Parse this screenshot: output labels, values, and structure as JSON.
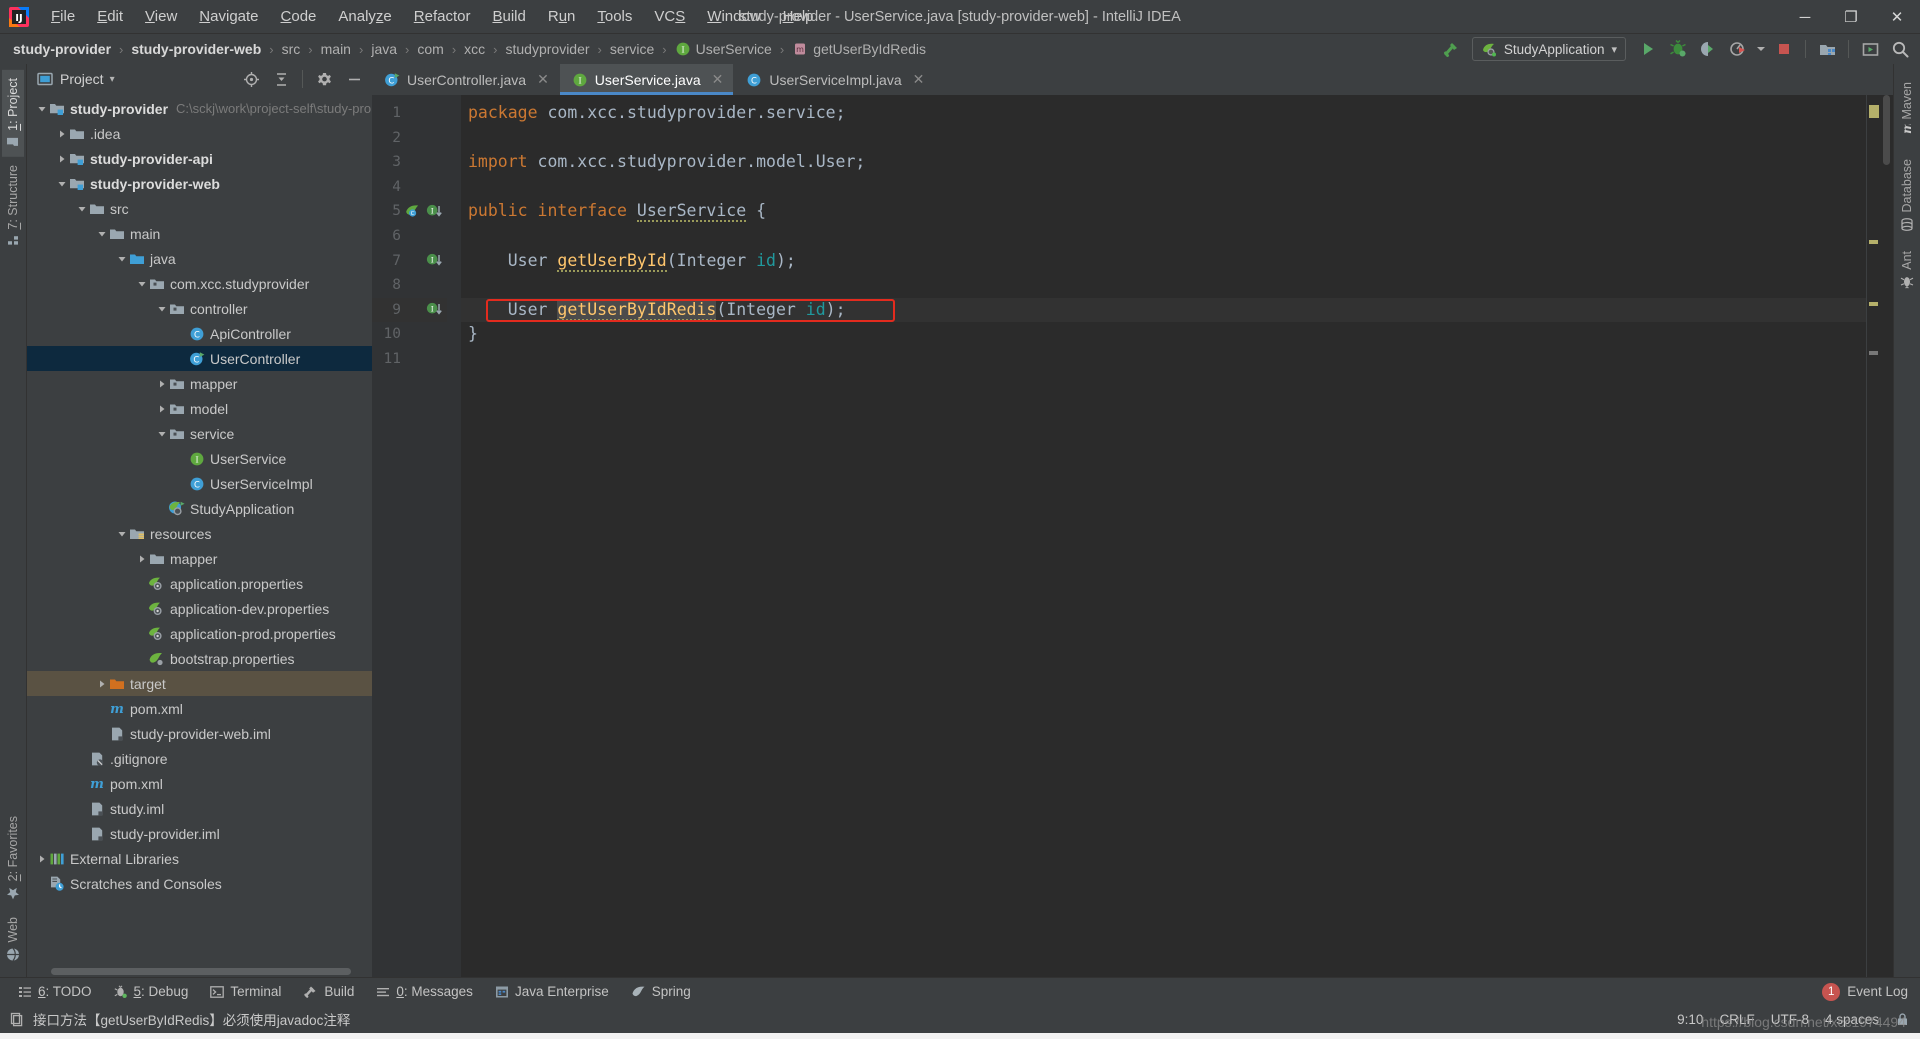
{
  "window": {
    "title": "study-provider - UserService.java [study-provider-web] - IntelliJ IDEA",
    "minimize": "─",
    "maximize": "❐",
    "close": "✕"
  },
  "menu": {
    "items": [
      {
        "label": "File",
        "mnemonic": "F"
      },
      {
        "label": "Edit",
        "mnemonic": "E"
      },
      {
        "label": "View",
        "mnemonic": "V"
      },
      {
        "label": "Navigate",
        "mnemonic": "N"
      },
      {
        "label": "Code",
        "mnemonic": "C"
      },
      {
        "label": "Analyze",
        "mnemonic": "z"
      },
      {
        "label": "Refactor",
        "mnemonic": "R"
      },
      {
        "label": "Build",
        "mnemonic": "B"
      },
      {
        "label": "Run",
        "mnemonic": "u"
      },
      {
        "label": "Tools",
        "mnemonic": "T"
      },
      {
        "label": "VCS",
        "mnemonic": "S"
      },
      {
        "label": "Window",
        "mnemonic": "W"
      },
      {
        "label": "Help",
        "mnemonic": "H"
      }
    ]
  },
  "breadcrumb": {
    "items": [
      {
        "label": "study-provider",
        "bold": true,
        "icon": ""
      },
      {
        "label": "study-provider-web",
        "bold": true,
        "icon": ""
      },
      {
        "label": "src",
        "bold": false,
        "icon": ""
      },
      {
        "label": "main",
        "bold": false,
        "icon": ""
      },
      {
        "label": "java",
        "bold": false,
        "icon": ""
      },
      {
        "label": "com",
        "bold": false,
        "icon": ""
      },
      {
        "label": "xcc",
        "bold": false,
        "icon": ""
      },
      {
        "label": "studyprovider",
        "bold": false,
        "icon": ""
      },
      {
        "label": "service",
        "bold": false,
        "icon": ""
      },
      {
        "label": "UserService",
        "bold": false,
        "icon": "interface-icon"
      },
      {
        "label": "getUserByIdRedis",
        "bold": false,
        "icon": "method-icon"
      }
    ],
    "separator": "›"
  },
  "toolbar": {
    "run_config": "StudyApplication",
    "dropdown_caret": "▾",
    "buttons": [
      {
        "name": "build-hammer",
        "title": "Build Project"
      },
      {
        "name": "run-button",
        "title": "Run"
      },
      {
        "name": "debug-button",
        "title": "Debug"
      },
      {
        "name": "run-coverage-button",
        "title": "Run with Coverage"
      },
      {
        "name": "profiler-button",
        "title": "Profile"
      },
      {
        "name": "stop-button",
        "title": "Stop"
      },
      {
        "name": "project-structure-button",
        "title": "Project Structure"
      },
      {
        "name": "select-in-button",
        "title": "Select In"
      },
      {
        "name": "search-everywhere-button",
        "title": "Search Everywhere"
      }
    ]
  },
  "left_strip": {
    "top": [
      {
        "label": "1: Project",
        "mnemonic": "1",
        "active": true,
        "icon": "project-icon"
      },
      {
        "label": "7: Structure",
        "mnemonic": "7",
        "active": false,
        "icon": "structure-icon"
      }
    ],
    "bottom": [
      {
        "label": "2: Favorites",
        "mnemonic": "2",
        "active": false,
        "icon": "star-icon"
      },
      {
        "label": "Web",
        "mnemonic": "",
        "active": false,
        "icon": "web-icon"
      }
    ]
  },
  "right_strip": {
    "items": [
      {
        "label": "Maven",
        "icon": "maven-icon"
      },
      {
        "label": "Database",
        "icon": "database-icon"
      },
      {
        "label": "Ant",
        "icon": "ant-icon"
      }
    ]
  },
  "project_panel": {
    "title": "Project",
    "title_caret": "▾",
    "header_buttons": [
      {
        "name": "locate-icon",
        "title": "Select Opened File"
      },
      {
        "name": "collapse-all-icon",
        "title": "Collapse All"
      },
      {
        "name": "settings-gear-icon",
        "title": "Settings"
      },
      {
        "name": "hide-icon",
        "title": "Hide"
      }
    ],
    "tree": [
      {
        "label": "study-provider",
        "path": "C:\\sckj\\work\\project-self\\study-pro",
        "depth": 0,
        "arrow": "open",
        "icon": "module-folder-icon",
        "bold": true,
        "state": "none"
      },
      {
        "label": ".idea",
        "path": "",
        "depth": 1,
        "arrow": "closed",
        "icon": "folder-icon",
        "bold": false,
        "state": "none"
      },
      {
        "label": "study-provider-api",
        "path": "",
        "depth": 1,
        "arrow": "closed",
        "icon": "module-folder-icon",
        "bold": true,
        "state": "none"
      },
      {
        "label": "study-provider-web",
        "path": "",
        "depth": 1,
        "arrow": "open",
        "icon": "module-folder-icon",
        "bold": true,
        "state": "none"
      },
      {
        "label": "src",
        "path": "",
        "depth": 2,
        "arrow": "open",
        "icon": "folder-icon",
        "bold": false,
        "state": "none"
      },
      {
        "label": "main",
        "path": "",
        "depth": 3,
        "arrow": "open",
        "icon": "folder-icon",
        "bold": false,
        "state": "none"
      },
      {
        "label": "java",
        "path": "",
        "depth": 4,
        "arrow": "open",
        "icon": "source-folder-icon",
        "bold": false,
        "state": "none"
      },
      {
        "label": "com.xcc.studyprovider",
        "path": "",
        "depth": 5,
        "arrow": "open",
        "icon": "package-icon",
        "bold": false,
        "state": "none"
      },
      {
        "label": "controller",
        "path": "",
        "depth": 6,
        "arrow": "open",
        "icon": "package-icon",
        "bold": false,
        "state": "none"
      },
      {
        "label": "ApiController",
        "path": "",
        "depth": 7,
        "arrow": "none",
        "icon": "class-icon",
        "bold": false,
        "state": "none"
      },
      {
        "label": "UserController",
        "path": "",
        "depth": 7,
        "arrow": "none",
        "icon": "class-run-icon",
        "bold": false,
        "state": "selected"
      },
      {
        "label": "mapper",
        "path": "",
        "depth": 6,
        "arrow": "closed",
        "icon": "package-icon",
        "bold": false,
        "state": "none"
      },
      {
        "label": "model",
        "path": "",
        "depth": 6,
        "arrow": "closed",
        "icon": "package-icon",
        "bold": false,
        "state": "none"
      },
      {
        "label": "service",
        "path": "",
        "depth": 6,
        "arrow": "open",
        "icon": "package-icon",
        "bold": false,
        "state": "none"
      },
      {
        "label": "UserService",
        "path": "",
        "depth": 7,
        "arrow": "none",
        "icon": "interface-icon",
        "bold": false,
        "state": "none"
      },
      {
        "label": "UserServiceImpl",
        "path": "",
        "depth": 7,
        "arrow": "none",
        "icon": "class-icon",
        "bold": false,
        "state": "none"
      },
      {
        "label": "StudyApplication",
        "path": "",
        "depth": 6,
        "arrow": "none",
        "icon": "spring-class-icon",
        "bold": false,
        "state": "none"
      },
      {
        "label": "resources",
        "path": "",
        "depth": 4,
        "arrow": "open",
        "icon": "resources-folder-icon",
        "bold": false,
        "state": "none"
      },
      {
        "label": "mapper",
        "path": "",
        "depth": 5,
        "arrow": "closed",
        "icon": "folder-icon",
        "bold": false,
        "state": "none"
      },
      {
        "label": "application.properties",
        "path": "",
        "depth": 5,
        "arrow": "none",
        "icon": "spring-props-icon",
        "bold": false,
        "state": "none"
      },
      {
        "label": "application-dev.properties",
        "path": "",
        "depth": 5,
        "arrow": "none",
        "icon": "spring-props-icon",
        "bold": false,
        "state": "none"
      },
      {
        "label": "application-prod.properties",
        "path": "",
        "depth": 5,
        "arrow": "none",
        "icon": "spring-props-icon",
        "bold": false,
        "state": "none"
      },
      {
        "label": "bootstrap.properties",
        "path": "",
        "depth": 5,
        "arrow": "none",
        "icon": "spring-leaf-icon",
        "bold": false,
        "state": "none"
      },
      {
        "label": "target",
        "path": "",
        "depth": 3,
        "arrow": "closed",
        "icon": "excluded-folder-icon",
        "bold": false,
        "state": "highlighted"
      },
      {
        "label": "pom.xml",
        "path": "",
        "depth": 3,
        "arrow": "none",
        "icon": "maven-pom-icon",
        "bold": false,
        "state": "none"
      },
      {
        "label": "study-provider-web.iml",
        "path": "",
        "depth": 3,
        "arrow": "none",
        "icon": "iml-icon",
        "bold": false,
        "state": "none"
      },
      {
        "label": ".gitignore",
        "path": "",
        "depth": 2,
        "arrow": "none",
        "icon": "gitignore-icon",
        "bold": false,
        "state": "none"
      },
      {
        "label": "pom.xml",
        "path": "",
        "depth": 2,
        "arrow": "none",
        "icon": "maven-pom-icon",
        "bold": false,
        "state": "none"
      },
      {
        "label": "study.iml",
        "path": "",
        "depth": 2,
        "arrow": "none",
        "icon": "iml-icon",
        "bold": false,
        "state": "none"
      },
      {
        "label": "study-provider.iml",
        "path": "",
        "depth": 2,
        "arrow": "none",
        "icon": "iml-icon",
        "bold": false,
        "state": "none"
      },
      {
        "label": "External Libraries",
        "path": "",
        "depth": 0,
        "arrow": "closed",
        "icon": "libraries-icon",
        "bold": false,
        "state": "none"
      },
      {
        "label": "Scratches and Consoles",
        "path": "",
        "depth": 0,
        "arrow": "none",
        "icon": "scratches-icon",
        "bold": false,
        "state": "none"
      }
    ]
  },
  "editor": {
    "tabs": [
      {
        "label": "UserController.java",
        "icon": "class-run-icon",
        "active": false,
        "close": "✕"
      },
      {
        "label": "UserService.java",
        "icon": "interface-icon",
        "active": true,
        "close": "✕"
      },
      {
        "label": "UserServiceImpl.java",
        "icon": "class-icon",
        "active": false,
        "close": "✕"
      }
    ],
    "line_numbers": [
      "1",
      "2",
      "3",
      "4",
      "5",
      "6",
      "7",
      "8",
      "9",
      "10",
      "11"
    ],
    "current_line": 9,
    "code_lines": [
      {
        "n": 1,
        "tokens": [
          {
            "t": "package ",
            "c": "kw"
          },
          {
            "t": "com.xcc.studyprovider.service;",
            "c": "plain"
          }
        ]
      },
      {
        "n": 2,
        "tokens": []
      },
      {
        "n": 3,
        "tokens": [
          {
            "t": "import ",
            "c": "kw"
          },
          {
            "t": "com.xcc.studyprovider.model.User;",
            "c": "plain"
          }
        ]
      },
      {
        "n": 4,
        "tokens": []
      },
      {
        "n": 5,
        "tokens": [
          {
            "t": "public ",
            "c": "kw"
          },
          {
            "t": "interface ",
            "c": "kw"
          },
          {
            "t": "UserService",
            "c": "cls warnu"
          },
          {
            "t": " {",
            "c": "plain"
          }
        ]
      },
      {
        "n": 6,
        "tokens": []
      },
      {
        "n": 7,
        "tokens": [
          {
            "t": "    ",
            "c": "plain"
          },
          {
            "t": "User ",
            "c": "typ"
          },
          {
            "t": "getUserById",
            "c": "mth warnu"
          },
          {
            "t": "(",
            "c": "plain"
          },
          {
            "t": "Integer ",
            "c": "typ"
          },
          {
            "t": "id",
            "c": "param"
          },
          {
            "t": ");",
            "c": "plain"
          }
        ]
      },
      {
        "n": 8,
        "tokens": []
      },
      {
        "n": 9,
        "tokens": [
          {
            "t": "    ",
            "c": "plain"
          },
          {
            "t": "User ",
            "c": "typ"
          },
          {
            "t": "getUserByIdRedis",
            "c": "mth warnu ident-hl"
          },
          {
            "t": "(",
            "c": "plain"
          },
          {
            "t": "Integer ",
            "c": "typ"
          },
          {
            "t": "id",
            "c": "param"
          },
          {
            "t": ");",
            "c": "plain"
          }
        ]
      },
      {
        "n": 10,
        "tokens": [
          {
            "t": "}",
            "c": "plain"
          }
        ]
      },
      {
        "n": 11,
        "tokens": []
      }
    ],
    "gutter_marks": [
      {
        "line": 5,
        "icons": [
          "spring-bean-icon",
          "implemented-icon"
        ]
      },
      {
        "line": 7,
        "icons": [
          "implemented-icon"
        ]
      },
      {
        "line": 9,
        "icons": [
          "implemented-icon"
        ]
      }
    ],
    "intention_bulb": {
      "line": 9,
      "icon": "lightbulb-icon"
    },
    "annotation_box": {
      "line": 9,
      "color": "#e32b1e",
      "label": "red-highlight-box"
    }
  },
  "tool_windows": {
    "items": [
      {
        "label": "6: TODO",
        "mnemonic": "6",
        "icon": "todo-icon"
      },
      {
        "label": "5: Debug",
        "mnemonic": "5",
        "icon": "debug-icon"
      },
      {
        "label": "Terminal",
        "mnemonic": "",
        "icon": "terminal-icon"
      },
      {
        "label": "Build",
        "mnemonic": "",
        "icon": "build-hammer-icon"
      },
      {
        "label": "0: Messages",
        "mnemonic": "0",
        "icon": "messages-icon"
      },
      {
        "label": "Java Enterprise",
        "mnemonic": "",
        "icon": "java-enterprise-icon"
      },
      {
        "label": "Spring",
        "mnemonic": "",
        "icon": "spring-icon"
      }
    ],
    "event_log": {
      "label": "Event Log",
      "count": "1"
    }
  },
  "status_bar": {
    "message": "接口方法【getUserByIdRedis】必须使用javadoc注释",
    "icon": "info-icon",
    "caret_position": "9:10",
    "line_separator": "CRLF",
    "encoding": "UTF-8",
    "indent": "4 spaces",
    "lock": "🔒"
  },
  "watermark": {
    "text": "https://blog.csdn.net/xcc1974494"
  },
  "colors": {
    "accent_blue": "#4a88c7",
    "selection_blue": "#0d293e",
    "error_red": "#e32b1e",
    "keyword_orange": "#cc7832",
    "string_green": "#6a8759",
    "method_yellow": "#ffc66d",
    "panel_bg": "#3c3f41",
    "editor_bg": "#2b2b2b"
  }
}
